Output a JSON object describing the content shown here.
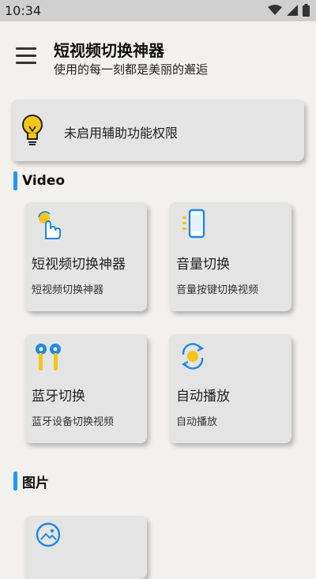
{
  "status": {
    "time": "10:34"
  },
  "header": {
    "title": "短视频切换神器",
    "subtitle": "使用的每一刻都是美丽的邂逅"
  },
  "notice": {
    "text": "未启用辅助功能权限"
  },
  "sections": [
    {
      "title": "Video"
    },
    {
      "title": "图片"
    }
  ],
  "cards": [
    {
      "title": "短视频切换神器",
      "desc": "短视频切换神器",
      "icon": "tap-hand-icon"
    },
    {
      "title": "音量切换",
      "desc": "音量按键切换视频",
      "icon": "phone-volume-icon"
    },
    {
      "title": "蓝牙切换",
      "desc": "蓝牙设备切换视频",
      "icon": "earbuds-icon"
    },
    {
      "title": "自动播放",
      "desc": "自动播放",
      "icon": "auto-rotate-icon"
    },
    {
      "title": "",
      "desc": "",
      "icon": "image-icon"
    }
  ],
  "colors": {
    "accent": "#2196f3",
    "icon_yellow": "#f5c518",
    "card_bg": "#e4e4e4",
    "page_bg": "#f2f1ee"
  }
}
